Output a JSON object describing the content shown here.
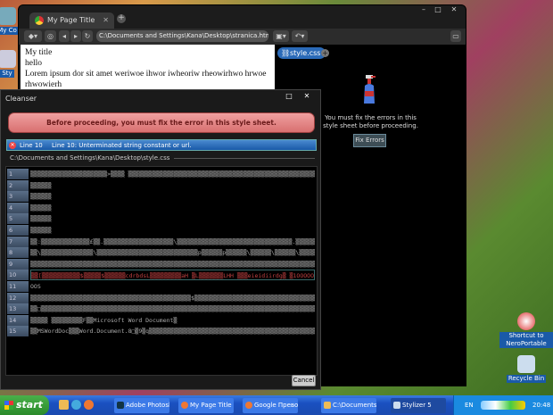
{
  "desktop": {
    "icons": [
      {
        "label": "My Co"
      },
      {
        "label": "Sty"
      },
      {
        "label": "Shortcut to NeroPortable"
      },
      {
        "label": "Recycle Bin"
      }
    ]
  },
  "browser": {
    "tab_title": "My Page Title",
    "address": "C:\\Documents and Settings\\Kana\\Desktop\\stranica.html",
    "page_lines": [
      "My title",
      "hello",
      "Lorem ipsum dor sit amet weriwoe ihwor iwheoriw rheowirhwo hrwoe",
      "rhwowierh"
    ],
    "css_tab": "style.css",
    "panel_message": "You must fix the errors in this style sheet before proceeding.",
    "fix_button": "Fix Errors"
  },
  "dialog": {
    "title": "Cleanser",
    "banner": "Before proceeding, you must fix the error in this style sheet.",
    "error_line": "Line 10",
    "error_message": "Line 10: Unterminated string constant or url.",
    "file_path": "C:\\Documents and Settings\\Kana\\Desktop\\style.css",
    "lines": [
      {
        "n": "1",
        "text": "▒▒▒▒▒▒▒▒▒▒▒▒▒▒▒▒▒▒▒▒▒▒>▒▒▒▒   ▒▒▒▒▒▒▒▒▒▒▒▒▒▒▒▒▒▒▒▒▒▒▒▒▒▒▒▒▒▒▒▒▒▒▒▒▒▒▒▒▒▒▒▒▒▒▒▒▒▒▒▒▒▒▒▒"
      },
      {
        "n": "2",
        "text": "▒▒▒▒▒▒"
      },
      {
        "n": "3",
        "text": "▒▒▒▒▒▒"
      },
      {
        "n": "4",
        "text": "▒▒▒▒▒▒"
      },
      {
        "n": "5",
        "text": "▒▒▒▒▒▒"
      },
      {
        "n": "6",
        "text": "▒▒▒▒▒▒"
      },
      {
        "n": "7",
        "text": "▒▒:▒▒▒▒▒▒▒▒▒▒▒▒▒▒£▒▒.▒▒▒▒▒▒▒▒▒▒▒▒▒▒▒▒▒▒▒▒\\▒▒▒▒▒▒▒▒▒▒▒▒▒▒▒▒▒▒▒▒▒▒▒▒▒▒▒▒▒▒▒▒▒.▒▒▒▒▒▒▒▒▒▒\\"
      },
      {
        "n": "8",
        "text": "▒▒\\▒▒▒▒▒▒▒▒▒▒▒▒▒▒▒\\▒▒▒▒▒▒▒▒▒▒▒▒▒▒▒▒▒▒▒▒▒▒▒▒▒▒▒▒▒p▒▒▒▒▒▒p▒▒▒▒▒▒\\▒▒▒▒▒▒\\▒▒▒▒▒▒\\▒▒▒▒▒▒▒▒▒▒▒▒▒▒▒▒▒▒"
      },
      {
        "n": "9",
        "text": "▒▒▒▒▒▒▒▒▒▒▒▒▒▒▒▒▒▒▒▒▒▒▒▒▒▒▒▒▒▒▒▒▒▒▒▒▒▒▒▒▒▒▒▒▒▒▒▒▒▒▒▒▒▒▒▒▒▒▒▒▒▒▒▒▒▒▒▒▒▒▒▒▒▒▒▒▒▒▒▒▒▒▒"
      },
      {
        "n": "10",
        "text": "▒▒[▒▒▒▒▒▒▒▒▒▒▒$▒▒▒▒▒$▒▒▒▒▒▒cdrbdsL▒▒▒▒▒▒▒▒▒aH   ▒L▒▒▒▒▒▒▒LHH   ▒▒▒eieidiirdg▒ ▒1OOOOOOOO$O"
      },
      {
        "n": "11",
        "text": "OOS"
      },
      {
        "n": "12",
        "text": "▒▒▒▒▒▒▒▒▒▒▒▒▒▒▒▒▒▒▒▒▒▒▒▒▒▒▒▒▒▒▒▒▒▒▒▒▒▒▒▒▒▒▒▒▒▒$▒▒▒▒▒▒▒▒▒▒▒▒▒▒▒▒▒▒▒▒▒▒▒▒▒▒▒▒▒▒▒▒▒▒▒▒▒▒▒▒▒"
      },
      {
        "n": "13",
        "text": "▒▒□▒▒▒▒▒▒▒▒▒▒▒▒▒▒▒▒▒▒▒▒▒▒▒▒▒▒▒▒▒▒▒▒▒▒▒▒▒▒▒▒▒▒▒▒▒▒▒▒▒▒▒▒▒▒▒▒▒▒▒▒▒▒▒▒▒▒▒▒▒▒▒▒▒▒▒▒▒▒▒▒▒"
      },
      {
        "n": "14",
        "text": "▒▒▒▒▒    ▒▒▒▒▒▒▒▒▒F▒▒Microsoft Word Document▒"
      },
      {
        "n": "15",
        "text": "▒▒MSWordDoc▒▒▒Word.Document.8□▒9▒q▒▒▒▒▒▒▒▒▒▒▒▒▒▒▒▒▒▒▒▒▒▒▒▒▒▒▒▒▒▒▒▒▒▒▒▒▒▒▒▒▒▒▒▒▒▒▒▒▒▒"
      }
    ],
    "error_line_index": 10,
    "cancel": "Cancel"
  },
  "taskbar": {
    "start": "start",
    "tasks": [
      {
        "label": "Adobe Photosh..."
      },
      {
        "label": "My Page Title - ..."
      },
      {
        "label": "Google Превод..."
      },
      {
        "label": "C:\\Documents ..."
      },
      {
        "label": "Stylizer 5"
      }
    ],
    "lang": "EN",
    "time": "20:48"
  }
}
